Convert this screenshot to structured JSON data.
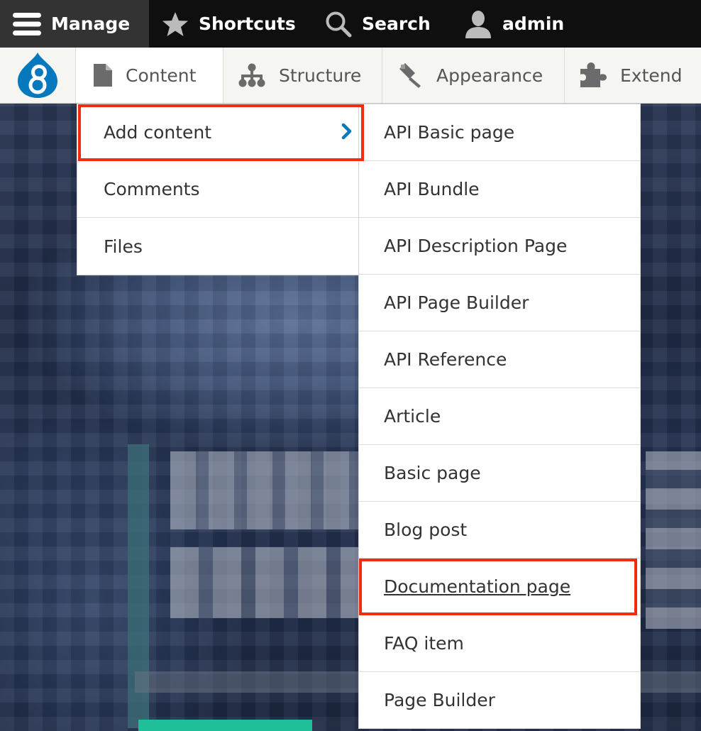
{
  "topbar": {
    "manage_label": "Manage",
    "shortcuts_label": "Shortcuts",
    "search_label": "Search",
    "user_label": "admin"
  },
  "tray": {
    "tabs": [
      {
        "label": "Content",
        "icon": "document-icon"
      },
      {
        "label": "Structure",
        "icon": "sitemap-icon"
      },
      {
        "label": "Appearance",
        "icon": "paint-icon"
      },
      {
        "label": "Extend",
        "icon": "puzzle-icon"
      }
    ]
  },
  "content_menu": {
    "items": [
      "Add content",
      "Comments",
      "Files"
    ]
  },
  "add_content_menu": {
    "items": [
      "API Basic page",
      "API Bundle",
      "API Description Page",
      "API Page Builder",
      "API Reference",
      "Article",
      "Basic page",
      "Blog post",
      "Documentation page",
      "FAQ item",
      "Page Builder"
    ]
  },
  "colors": {
    "highlight": "#f02d14",
    "toolbar_bg": "#0f0f0f",
    "manage_bg": "#333333",
    "drupal_blue": "#0678be"
  }
}
